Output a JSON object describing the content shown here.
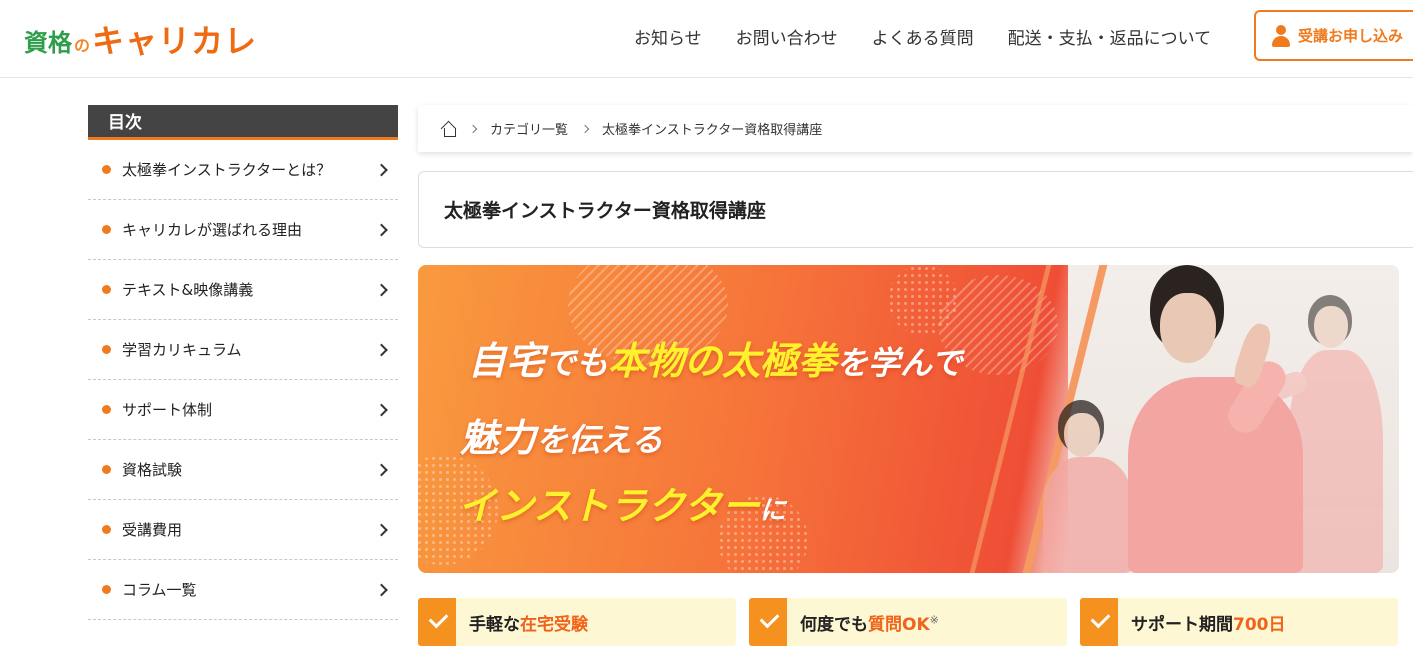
{
  "header": {
    "logo_small": "資格",
    "logo_no": "の",
    "logo_main": "キャリカレ",
    "nav": [
      "お知らせ",
      "お問い合わせ",
      "よくある質問",
      "配送・支払・返品について"
    ],
    "apply_label": "受講お申し込み"
  },
  "toc": {
    "title": "目次",
    "items": [
      "太極拳インストラクターとは？",
      "キャリカレが選ばれる理由",
      "テキスト&映像講義",
      "学習カリキュラム",
      "サポート体制",
      "資格試験",
      "受講費用",
      "コラム一覧"
    ]
  },
  "breadcrumb": {
    "items": [
      "カテゴリ一覧",
      "太極拳インストラクター資格取得講座"
    ]
  },
  "page": {
    "title": "太極拳インストラクター資格取得講座"
  },
  "banner": {
    "line1_a": "自宅",
    "line1_b": "でも",
    "line1_c": "本物の太極拳",
    "line1_d": "を学んで",
    "line2_a": "魅力",
    "line2_b": "を伝える",
    "line3_a": "インストラクター",
    "line3_b": "に"
  },
  "features": [
    {
      "pre": "手軽な",
      "hl": "在宅受験",
      "sup": ""
    },
    {
      "pre": "何度でも",
      "hl": "質問OK",
      "sup": "※"
    },
    {
      "pre": "サポート期間",
      "hl": "700日",
      "sup": ""
    }
  ],
  "colors": {
    "accent": "#f07a1e",
    "logo_green": "#2e9e4c",
    "toc_header": "#444444",
    "feature_bg": "#fdf7d4",
    "highlight_yellow": "#fff12b"
  }
}
